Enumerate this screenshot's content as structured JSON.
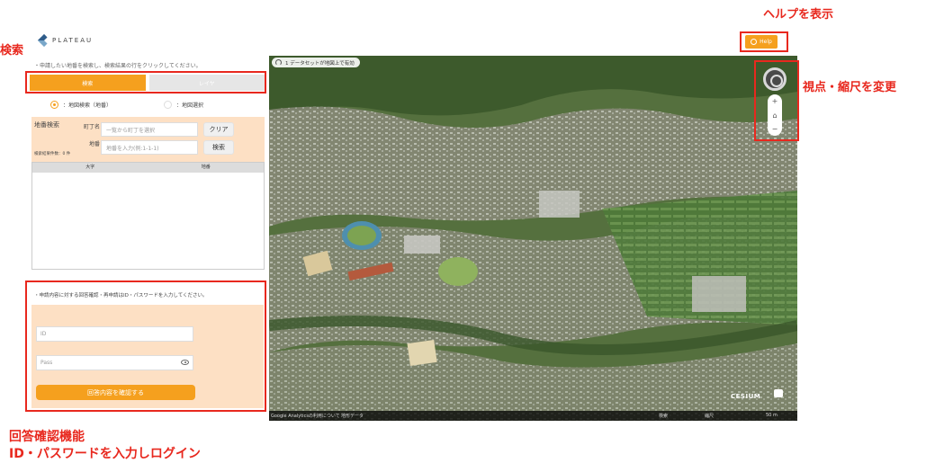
{
  "annotations": {
    "tab_switch": "検索・レイヤのタブ切替",
    "help": "ヘルプを表示",
    "view_zoom": "視点・縮尺を変更",
    "login_line1": "回答確認機能",
    "login_line2": "ID・パスワードを入力しログイン"
  },
  "app": {
    "logo_text": "PLATEAU",
    "instruction": "・申請したい地番を検索し、検索結果の行をクリックしてください。"
  },
  "tabs": {
    "search": "検索",
    "layer": "レイヤ"
  },
  "radios": {
    "parcel_search": "：地図検索（地番）",
    "map_select": "：地図選択"
  },
  "search": {
    "section_label": "地番検索",
    "town_label": "町丁名",
    "town_placeholder": "一覧から町丁を選択",
    "clear_button": "クリア",
    "parcel_label": "地番",
    "parcel_placeholder": "地番を入力(例:1-1-1)",
    "search_button": "検索",
    "result_count": "検索結果件数：0 件"
  },
  "table": {
    "columns": [
      "大字",
      "地番"
    ]
  },
  "login": {
    "hint": "・申請内容に対する回答確認・再申請はID・パスワードを入力してください。",
    "id_placeholder": "ID",
    "pass_placeholder": "Pass",
    "submit": "回答内容を確認する"
  },
  "map": {
    "dataset_chip": "1 データセットが地図上で有効",
    "footer_left": "Google Analyticsの利用について",
    "footer_data": "地形データ",
    "footer_mid1": "検索",
    "footer_mid2": "縮尺",
    "footer_scale": "50 m",
    "cesium": "CESIUM"
  },
  "nav": {
    "zoom_in": "+",
    "home": "⌂",
    "zoom_out": "−"
  },
  "help_button": "Help",
  "colors": {
    "accent": "#f5a01e",
    "annotation": "#e8281e",
    "panel": "#fde0c4"
  }
}
